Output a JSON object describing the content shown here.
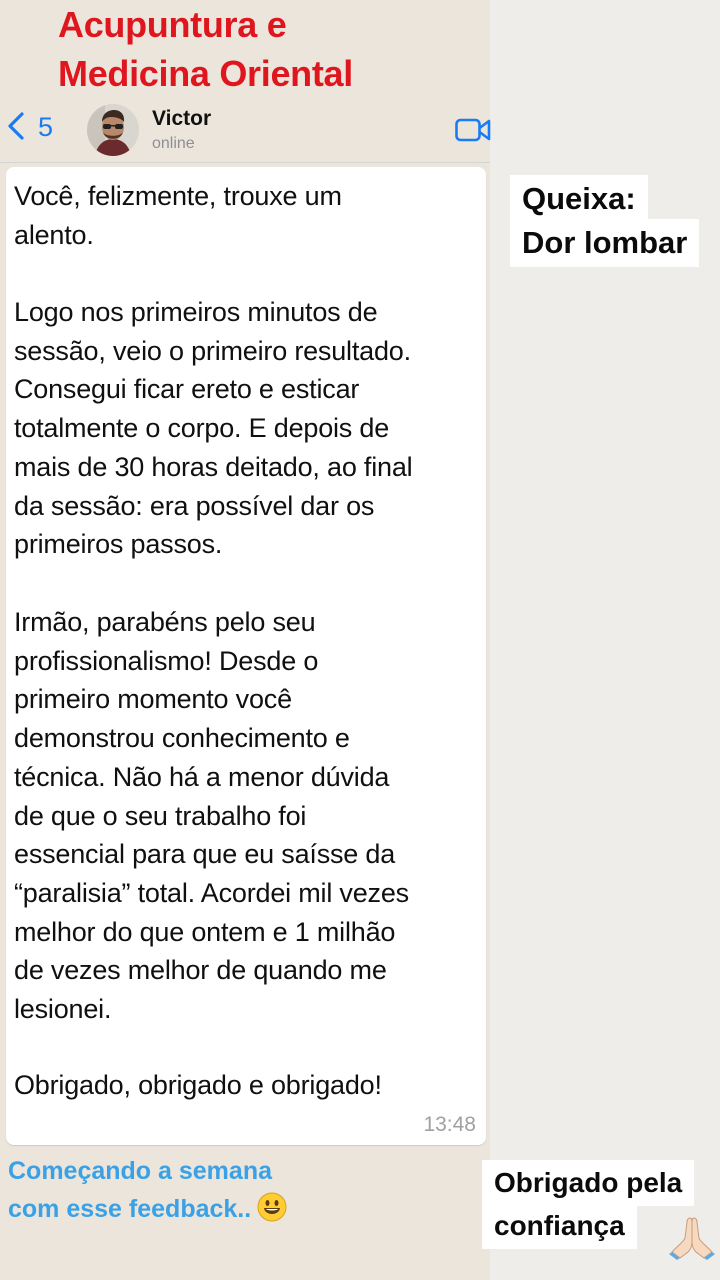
{
  "brand": {
    "title_line1": "Acupuntura e",
    "title_line2": "Medicina Oriental",
    "title_color": "#e0161e"
  },
  "chat": {
    "back_count": "5",
    "contact_name": "Victor",
    "contact_status": "online",
    "accent_color": "#1a7cf2",
    "header_icons": [
      "chevron-left-icon",
      "video-camera-icon"
    ]
  },
  "message": {
    "paragraphs": [
      "Você, felizmente, trouxe um\nalento.",
      "Logo nos primeiros minutos de\nsessão, veio o primeiro resultado.\nConsegui ficar ereto e esticar\ntotalmente o corpo. E depois de\nmais de 30 horas deitado, ao final\nda sessão: era possível dar os\nprimeiros passos.",
      "Irmão, parabéns pelo seu\nprofissionalismo! Desde o\nprimeiro momento você\ndemonstrou conhecimento e\ntécnica. Não há a menor dúvida\nde que o seu trabalho foi\nessencial para que eu saísse da\n“paralisia” total. Acordei mil vezes\nmelhor do que ontem e 1 milhão\nde vezes melhor de quando me\nlesionei.",
      "Obrigado, obrigado e obrigado!"
    ],
    "time": "13:48"
  },
  "labels": {
    "complaint_title": "Queixa:",
    "complaint_detail": "Dor lombar",
    "thanks_line1": "Obrigado pela",
    "thanks_line2": "confiança",
    "thanks_emoji": "praying-hands-icon"
  },
  "caption": {
    "line1": "Começando a semana",
    "line2": "com esse feedback..",
    "emoji": "smiling-face-icon",
    "color": "#3aa1e6"
  }
}
